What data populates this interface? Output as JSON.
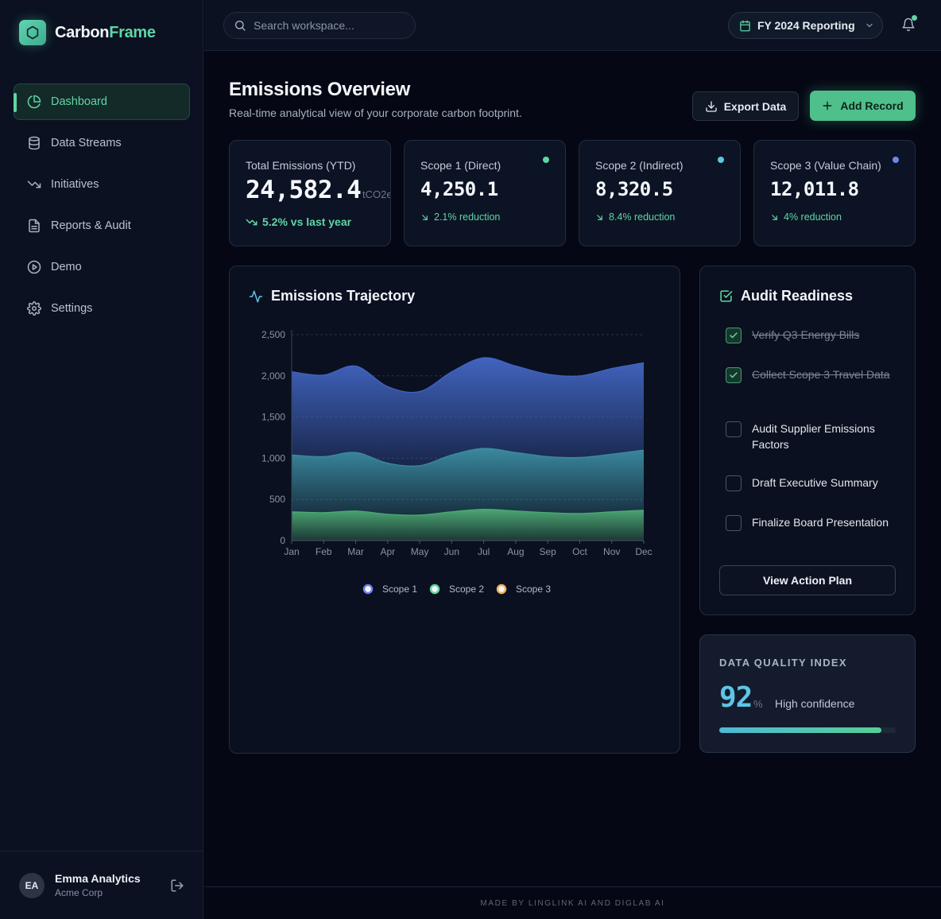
{
  "app": {
    "brand_part1": "Carbon",
    "brand_part2": "Frame"
  },
  "sidebar": {
    "items": [
      {
        "label": "Dashboard",
        "icon": "pie-chart-icon",
        "active": true
      },
      {
        "label": "Data Streams",
        "icon": "database-icon"
      },
      {
        "label": "Initiatives",
        "icon": "trending-down-icon"
      },
      {
        "label": "Reports & Audit",
        "icon": "file-text-icon"
      },
      {
        "label": "Demo",
        "icon": "play-circle-icon"
      },
      {
        "label": "Settings",
        "icon": "gear-icon"
      }
    ],
    "user": {
      "initials": "EA",
      "name": "Emma Analytics",
      "org": "Acme Corp"
    }
  },
  "header": {
    "search_placeholder": "Search workspace...",
    "period": "FY 2024 Reporting"
  },
  "page": {
    "title": "Emissions Overview",
    "subtitle": "Real-time analytical view of your corporate carbon footprint.",
    "export_label": "Export Data",
    "add_label": "Add Record"
  },
  "kpis": [
    {
      "label": "Total Emissions (YTD)",
      "value": "24,582.4",
      "unit": "tCO2e",
      "delta": "5.2% vs last year"
    },
    {
      "label": "Scope 1 (Direct)",
      "value": "4,250.1",
      "delta": "2.1% reduction",
      "dot_color": "#5fd6a4"
    },
    {
      "label": "Scope 2 (Indirect)",
      "value": "8,320.5",
      "delta": "8.4% reduction",
      "dot_color": "#5cc6e4"
    },
    {
      "label": "Scope 3 (Value Chain)",
      "value": "12,011.8",
      "delta": "4% reduction",
      "dot_color": "#6f86f0"
    }
  ],
  "chart": {
    "title": "Emissions Trajectory"
  },
  "chart_data": {
    "type": "area",
    "stacked": true,
    "categories": [
      "Jan",
      "Feb",
      "Mar",
      "Apr",
      "May",
      "Jun",
      "Jul",
      "Aug",
      "Sep",
      "Oct",
      "Nov",
      "Dec"
    ],
    "ylim": [
      0,
      2500
    ],
    "yticks": [
      "0",
      "500",
      "1,000",
      "1,500",
      "2,000",
      "2,500"
    ],
    "grid": true,
    "legend_position": "bottom",
    "series": [
      {
        "name": "Scope 1",
        "color": "#4fae77",
        "values": [
          350,
          340,
          360,
          320,
          310,
          350,
          380,
          360,
          340,
          330,
          350,
          370
        ]
      },
      {
        "name": "Scope 2",
        "color": "#3d8fa5",
        "values": [
          690,
          680,
          710,
          620,
          600,
          690,
          740,
          710,
          680,
          680,
          700,
          730
        ]
      },
      {
        "name": "Scope 3",
        "color": "#4468c8",
        "values": [
          1010,
          990,
          1050,
          930,
          900,
          1010,
          1100,
          1050,
          1000,
          990,
          1040,
          1060
        ]
      }
    ],
    "legend_marker_colors": [
      "#6f7ff0",
      "#5fd6a4",
      "#f0b35b"
    ]
  },
  "audit": {
    "title": "Audit Readiness",
    "tasks": [
      {
        "label": "Verify Q3 Energy Bills",
        "done": true
      },
      {
        "label": "Collect Scope 3 Travel Data",
        "done": true
      },
      {
        "label": "Audit Supplier Emissions Factors",
        "done": false
      },
      {
        "label": "Draft Executive Summary",
        "done": false
      },
      {
        "label": "Finalize Board Presentation",
        "done": false
      }
    ],
    "button_label": "View Action Plan"
  },
  "data_quality": {
    "title": "DATA QUALITY INDEX",
    "value": "92",
    "unit": "%",
    "status": "High confidence",
    "progress": 0.92
  },
  "footer": {
    "text": "MADE BY LINGLINK AI AND DIGLAB AI"
  }
}
